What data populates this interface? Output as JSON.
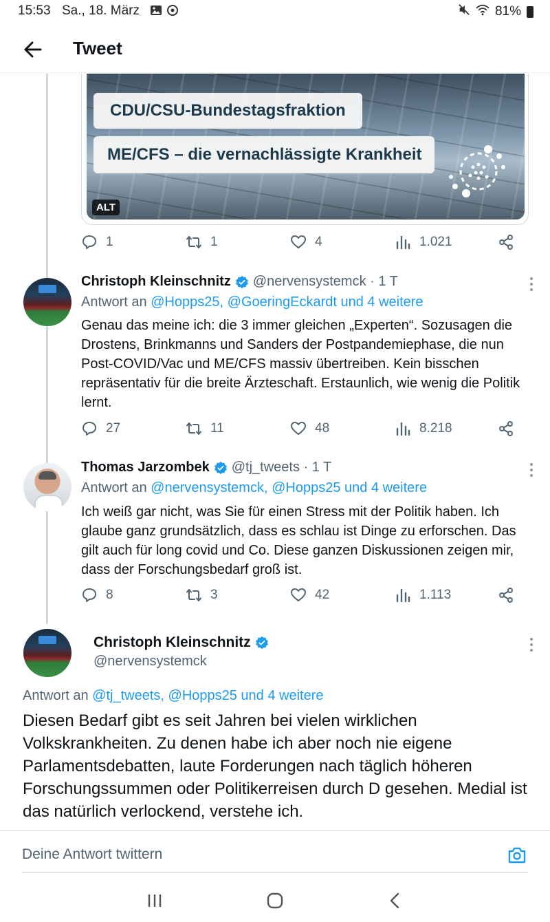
{
  "status_bar": {
    "time": "15:53",
    "date": "Sa., 18. März",
    "battery": "81%"
  },
  "header": {
    "title": "Tweet"
  },
  "media": {
    "line1": "CDU/CSU-Bundestagsfraktion",
    "line2": "ME/CFS – die vernachlässigte Krankheit",
    "alt_badge": "ALT"
  },
  "media_actions": {
    "replies": "1",
    "retweets": "1",
    "likes": "4",
    "views": "1.021"
  },
  "tweets": [
    {
      "name": "Christoph Kleinschnitz",
      "handle": "@nervensystemck · 1 T",
      "reply_prefix": "Antwort an ",
      "reply_mentions": "@Hopps25, @GoeringEckardt und 4 weitere",
      "text": "Genau das meine ich: die 3 immer gleichen „Experten“. Sozusagen die Drostens, Brinkmanns und Sanders der Postpandemiephase, die nun Post-COVID/Vac und ME/CFS massiv übertreiben. Kein bisschen repräsentativ für die breite Ärzteschaft. Erstaunlich, wie wenig die Politik lernt.",
      "replies": "27",
      "retweets": "11",
      "likes": "48",
      "views": "8.218"
    },
    {
      "name": "Thomas Jarzombek",
      "handle": "@tj_tweets · 1 T",
      "reply_prefix": "Antwort an ",
      "reply_mentions": "@nervensystemck, @Hopps25 und 4 weitere",
      "text": "Ich weiß gar nicht, was Sie für einen Stress mit der Politik haben. Ich glaube ganz grundsätzlich, dass es schlau ist Dinge zu erforschen. Das gilt auch für long covid und Co. Diese ganzen Diskussionen zeigen mir, dass der Forschungsbedarf groß ist.",
      "replies": "8",
      "retweets": "3",
      "likes": "42",
      "views": "1.113"
    }
  ],
  "main_tweet": {
    "name": "Christoph Kleinschnitz",
    "handle": "@nervensystemck",
    "reply_prefix": "Antwort an ",
    "reply_mentions": "@tj_tweets, @Hopps25 und 4 weitere",
    "text": "Diesen Bedarf gibt es seit Jahren bei vielen wirklichen Volkskrankheiten. Zu denen habe ich aber noch nie eigene Parlamentsdebatten, laute Forderungen nach täglich höheren Forschungssummen oder Politikerreisen durch D gesehen. Medial ist das natürlich verlockend, verstehe ich."
  },
  "reply_bar": {
    "placeholder": "Deine Antwort twittern"
  },
  "colors": {
    "accent": "#1d9bf0",
    "secondary_text": "#536471",
    "border": "#cfd9de"
  }
}
